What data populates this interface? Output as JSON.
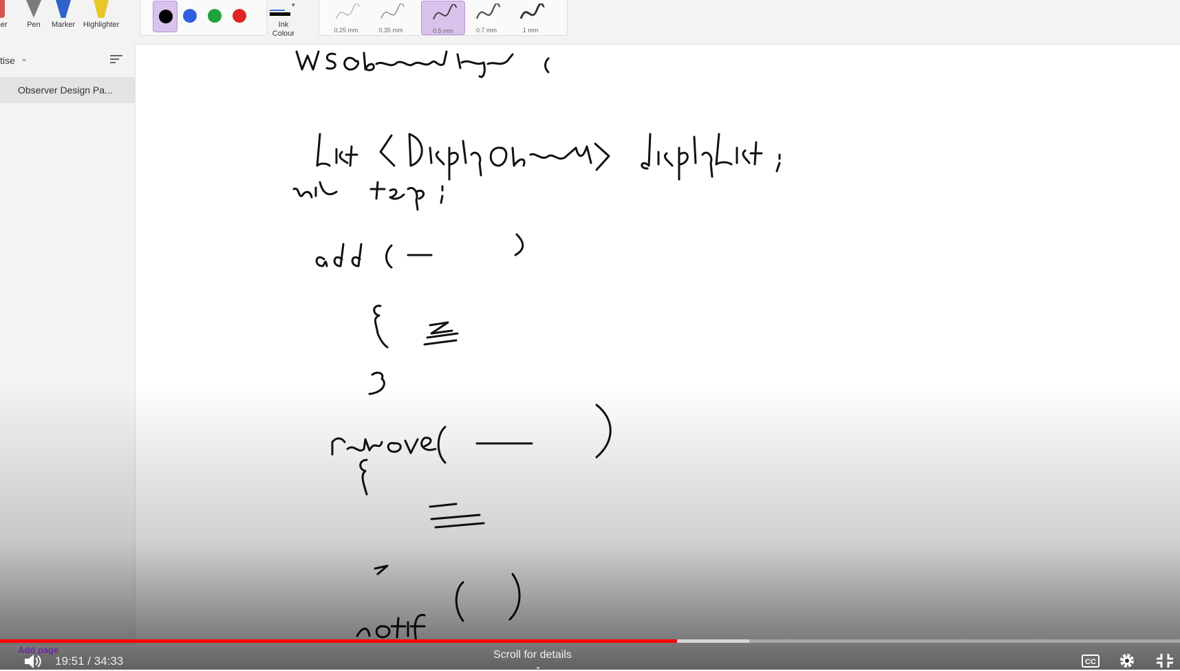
{
  "ribbon": {
    "tools": [
      {
        "id": "eraser",
        "label": "aser"
      },
      {
        "id": "pen",
        "label": "Pen"
      },
      {
        "id": "marker",
        "label": "Marker"
      },
      {
        "id": "highlighter",
        "label": "Highlighter"
      }
    ],
    "colors": [
      {
        "name": "black",
        "hex": "#000000",
        "selected": true
      },
      {
        "name": "blue",
        "hex": "#2f5fe0"
      },
      {
        "name": "green",
        "hex": "#1fa33a"
      },
      {
        "name": "red",
        "hex": "#e02424"
      }
    ],
    "ink_colour_label": "Ink Colour",
    "thickness": [
      {
        "label": "0.25 mm"
      },
      {
        "label": "0.35 mm"
      },
      {
        "label": "0.5 mm",
        "selected": true
      },
      {
        "label": "0.7 mm"
      },
      {
        "label": "1 mm"
      }
    ]
  },
  "sidebar": {
    "section_title": "tise",
    "page_item": "Observer  Design Pa..."
  },
  "canvas": {
    "handwriting_lines": [
      "WS Observable Impl {",
      "List < DisplayObservable > displayList ;",
      "int temp ;",
      "add ( — )",
      "{ ≡ }",
      "remove ( — )",
      "{ ≡ }",
      "notify ( )"
    ]
  },
  "video": {
    "add_page_label": "Add page",
    "current_time": "19:51",
    "duration": "34:33",
    "time_display": "19:51 / 34:33",
    "progress_played_fraction": 0.574,
    "progress_buffered_fraction": 0.635,
    "scroll_hint": "Scroll for details",
    "cc_label": "CC",
    "accent_color": "#ff0000"
  }
}
